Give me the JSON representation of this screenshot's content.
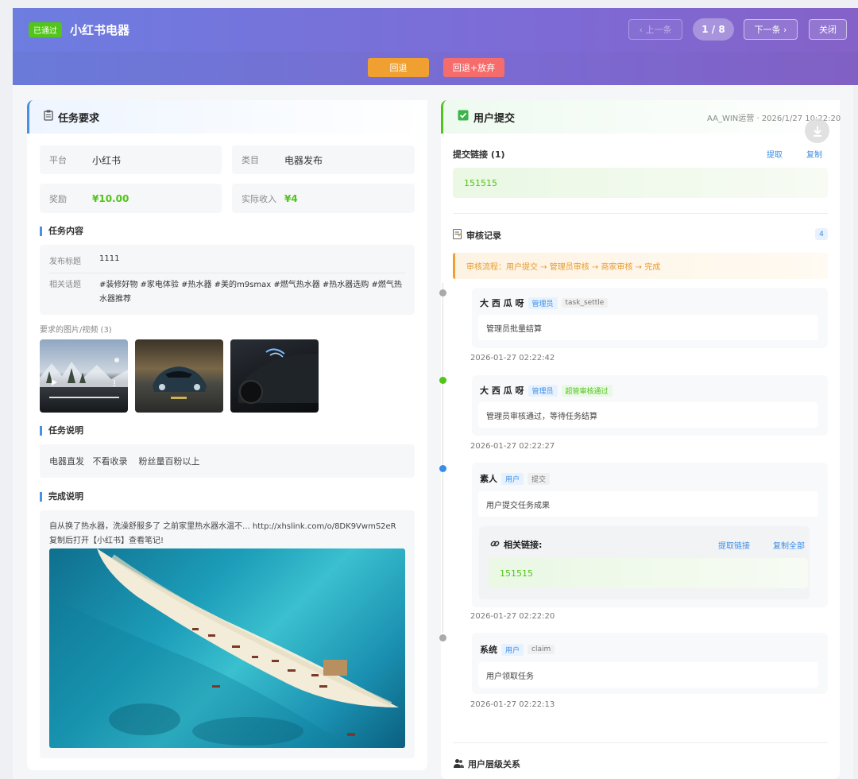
{
  "header": {
    "status_badge": "已通过",
    "title": "小红书电器",
    "prev_label": "‹ 上一条",
    "pager": "1 / 8",
    "next_label": "下一条 ›",
    "close_label": "关闭"
  },
  "actions": {
    "rollback_label": "回退",
    "rollback_abandon_label": "回退+放弃"
  },
  "task": {
    "heading": "任务要求",
    "platform_key": "平台",
    "platform_val": "小红书",
    "category_key": "类目",
    "category_val": "电器发布",
    "reward_key": "奖励",
    "reward_val": "¥10.00",
    "income_key": "实际收入",
    "income_val": "¥4",
    "content_title": "任务内容",
    "post_title_key": "发布标题",
    "post_title_val": "1111",
    "topics_key": "相关话题",
    "topics_val": "#装修好物 #家电体验 #热水器 #美的m9smax #燃气热水器 #热水器选购 #燃气热水器推荐",
    "media_label": "要求的图片/视频 (3)",
    "desc_title": "任务说明",
    "desc_text": "电器直发   不看收录    粉丝量百粉以上",
    "done_title": "完成说明",
    "done_text_1": "自从换了热水器，洗澡舒服多了 之前家里热水器水温不... http://xhslink.com/o/8DK9VwmS2eR",
    "done_text_2": "复制后打开【小红书】查看笔记!"
  },
  "submission": {
    "heading": "用户提交",
    "meta": "AA_WIN运营 · 2026/1/27 10:22:20",
    "links_label": "提交链接 (1)",
    "extract_label": "提取",
    "copy_label": "复制",
    "link_value": "151515",
    "review_title": "审核记录",
    "review_count": "4",
    "flow_text": "审核流程：用户提交 → 管理员审核 → 商家审核 → 完成",
    "records": [
      {
        "name": "大 西 瓜 呀",
        "tag1": "管理员",
        "tag2": "task_settle",
        "msg": "管理员批量结算",
        "time": "2026-01-27 02:22:42"
      },
      {
        "name": "大 西 瓜 呀",
        "tag1": "管理员",
        "tag2": "超管审核通过",
        "msg": "管理员审核通过，等待任务结算",
        "time": "2026-01-27 02:22:27"
      },
      {
        "name": "素人",
        "tag1": "用户",
        "tag2": "提交",
        "msg": "用户提交任务成果",
        "time": "2026-01-27 02:22:20",
        "links_title": "相关链接:",
        "links_extract": "提取链接",
        "links_copy_all": "复制全部",
        "link_value": "151515"
      },
      {
        "name": "系统",
        "tag1": "用户",
        "tag2": "claim",
        "msg": "用户领取任务",
        "time": "2026-01-27 02:22:13"
      }
    ],
    "hierarchy_title": "用户层级关系"
  },
  "colors": {
    "accent_blue": "#4a90e2",
    "success_green": "#52c41a",
    "rollback_orange": "#f0a030",
    "abandon_red": "#f56c6c"
  }
}
